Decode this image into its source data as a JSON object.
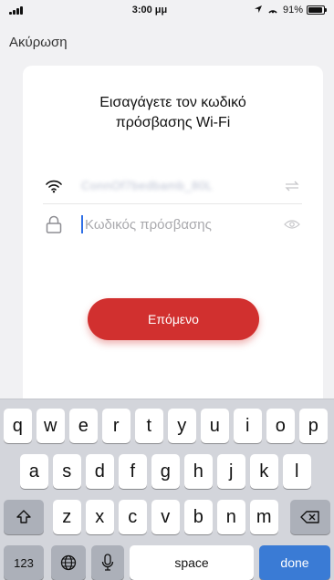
{
  "status_bar": {
    "time": "3:00 μμ",
    "battery_percent": "91%",
    "battery_level": 0.91
  },
  "header": {
    "cancel_label": "Ακύρωση"
  },
  "card": {
    "title": "Εισαγάγετε τον κωδικό\nπρόσβασης Wi-Fi",
    "ssid_value": "ConnOf7bedbamb_80L",
    "password_placeholder": "Κωδικός πρόσβασης",
    "password_value": "",
    "next_label": "Επόμενο"
  },
  "keyboard": {
    "row1": [
      "q",
      "w",
      "e",
      "r",
      "t",
      "y",
      "u",
      "i",
      "o",
      "p"
    ],
    "row2": [
      "a",
      "s",
      "d",
      "f",
      "g",
      "h",
      "j",
      "k",
      "l"
    ],
    "row3": [
      "z",
      "x",
      "c",
      "v",
      "b",
      "n",
      "m"
    ],
    "numbers_label": "123",
    "space_label": "space",
    "done_label": "done"
  },
  "colors": {
    "accent_red": "#d1302f",
    "keyboard_bg": "#d3d5db",
    "done_blue": "#3a7bd5"
  }
}
